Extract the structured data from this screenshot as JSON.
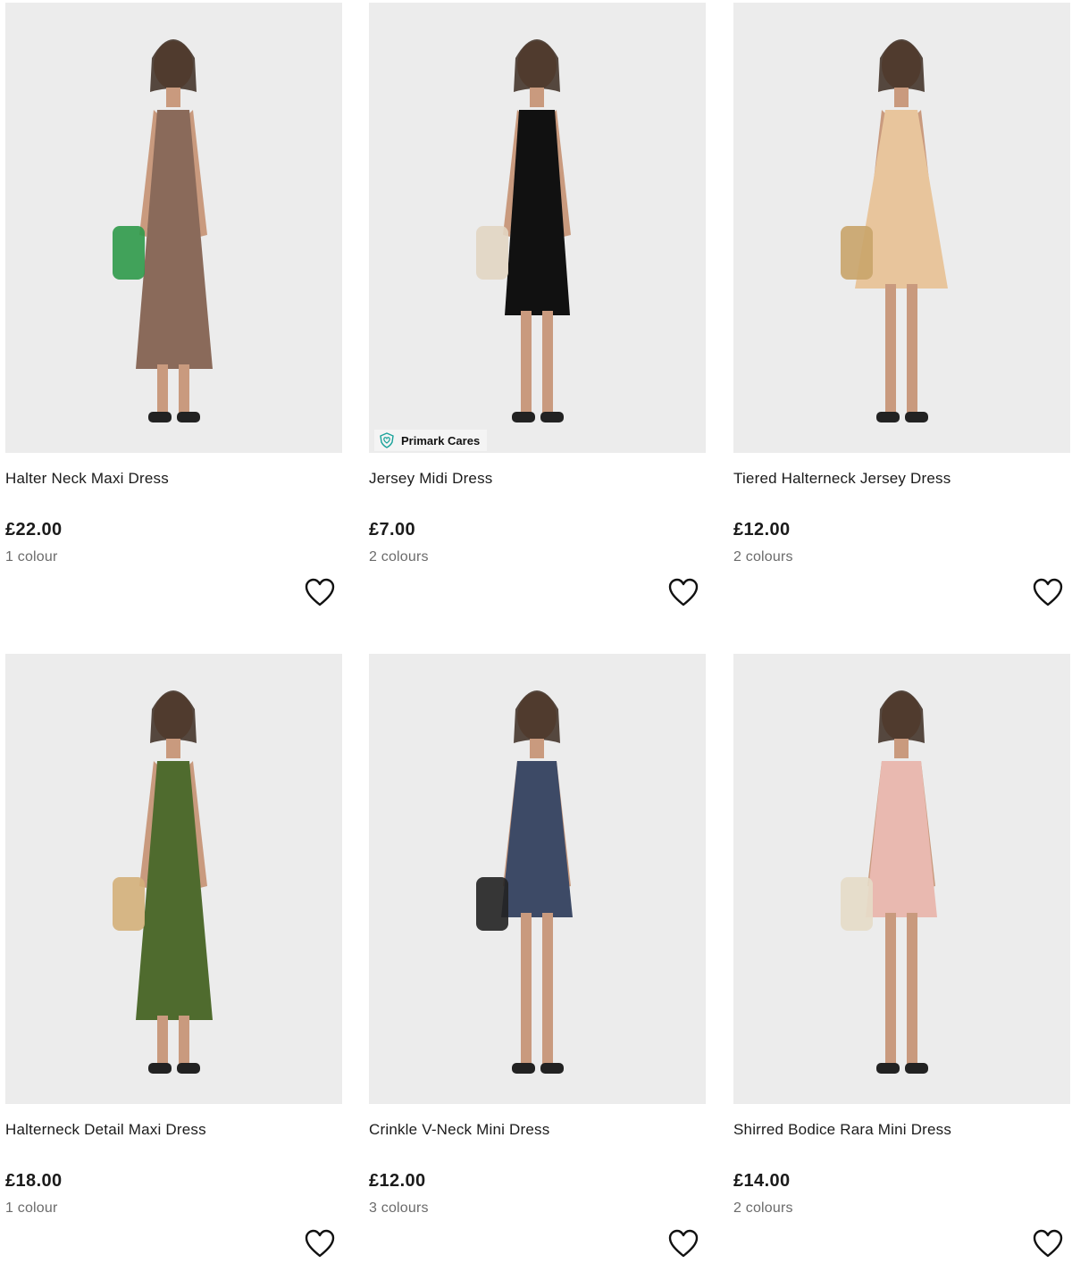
{
  "products": [
    {
      "name": "Halter Neck Maxi Dress",
      "price": "£22.00",
      "colours": "1 colour",
      "badge": null,
      "dress_color": "#8a6a5a",
      "accent_color": "#2f9a4a",
      "style": "maxi",
      "wishlist_icon": "heart-outline-icon"
    },
    {
      "name": "Jersey Midi Dress",
      "price": "£7.00",
      "colours": "2 colours",
      "badge": "Primark Cares",
      "dress_color": "#111111",
      "accent_color": "#e2d6c3",
      "style": "midi",
      "wishlist_icon": "heart-outline-icon"
    },
    {
      "name": "Tiered Halterneck Jersey Dress",
      "price": "£12.00",
      "colours": "2 colours",
      "badge": null,
      "dress_color": "#e8c59c",
      "accent_color": "#c9a46a",
      "style": "short",
      "wishlist_icon": "heart-outline-icon"
    },
    {
      "name": "Halterneck Detail Maxi Dress",
      "price": "£18.00",
      "colours": "1 colour",
      "badge": null,
      "dress_color": "#4f6b2e",
      "accent_color": "#d4b07a",
      "style": "maxi",
      "wishlist_icon": "heart-outline-icon"
    },
    {
      "name": "Crinkle V-Neck Mini Dress",
      "price": "£12.00",
      "colours": "3 colours",
      "badge": null,
      "dress_color": "#3d4a66",
      "accent_color": "#222222",
      "style": "mini",
      "wishlist_icon": "heart-outline-icon"
    },
    {
      "name": "Shirred Bodice Rara Mini Dress",
      "price": "£14.00",
      "colours": "2 colours",
      "badge": null,
      "dress_color": "#e9b9b0",
      "accent_color": "#e6dcc8",
      "style": "mini",
      "wishlist_icon": "heart-outline-icon"
    }
  ],
  "badge_icon": "heart-shield-icon"
}
